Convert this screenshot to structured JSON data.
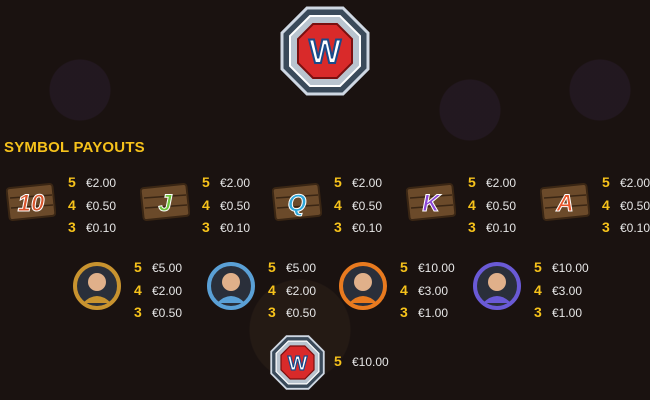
{
  "title": "SYMBOL PAYOUTS",
  "colors": {
    "accent": "#f6c21b",
    "text": "#e6e6e6",
    "wild_red": "#d92a2a",
    "background": "#1a1210"
  },
  "wild_top": {
    "icon": "wild-w-icon",
    "letter": "W"
  },
  "row1": [
    {
      "icon": "card-10-icon",
      "letter": "10",
      "color": "#d9542a",
      "pays": [
        {
          "count": "5",
          "amount": "€2.00"
        },
        {
          "count": "4",
          "amount": "€0.50"
        },
        {
          "count": "3",
          "amount": "€0.10"
        }
      ]
    },
    {
      "icon": "card-j-icon",
      "letter": "J",
      "color": "#6cc23a",
      "pays": [
        {
          "count": "5",
          "amount": "€2.00"
        },
        {
          "count": "4",
          "amount": "€0.50"
        },
        {
          "count": "3",
          "amount": "€0.10"
        }
      ]
    },
    {
      "icon": "card-q-icon",
      "letter": "Q",
      "color": "#2fa7d9",
      "pays": [
        {
          "count": "5",
          "amount": "€2.00"
        },
        {
          "count": "4",
          "amount": "€0.50"
        },
        {
          "count": "3",
          "amount": "€0.10"
        }
      ]
    },
    {
      "icon": "card-k-icon",
      "letter": "K",
      "color": "#8b46d6",
      "pays": [
        {
          "count": "5",
          "amount": "€2.00"
        },
        {
          "count": "4",
          "amount": "€0.50"
        },
        {
          "count": "3",
          "amount": "€0.10"
        }
      ]
    },
    {
      "icon": "card-a-icon",
      "letter": "A",
      "color": "#e8562a",
      "pays": [
        {
          "count": "5",
          "amount": "€2.00"
        },
        {
          "count": "4",
          "amount": "€0.50"
        },
        {
          "count": "3",
          "amount": "€0.10"
        }
      ]
    }
  ],
  "row2": [
    {
      "icon": "bearded-fighter-icon",
      "ring": "#c8932f",
      "pays": [
        {
          "count": "5",
          "amount": "€5.00"
        },
        {
          "count": "4",
          "amount": "€2.00"
        },
        {
          "count": "3",
          "amount": "€0.50"
        }
      ]
    },
    {
      "icon": "silver-fighter-icon",
      "ring": "#5aa0d6",
      "pays": [
        {
          "count": "5",
          "amount": "€5.00"
        },
        {
          "count": "4",
          "amount": "€2.00"
        },
        {
          "count": "3",
          "amount": "€0.50"
        }
      ]
    },
    {
      "icon": "blonde-fighter-icon",
      "ring": "#e87a1f",
      "pays": [
        {
          "count": "5",
          "amount": "€10.00"
        },
        {
          "count": "4",
          "amount": "€3.00"
        },
        {
          "count": "3",
          "amount": "€1.00"
        }
      ]
    },
    {
      "icon": "masked-ninja-icon",
      "ring": "#6a5ad6",
      "pays": [
        {
          "count": "5",
          "amount": "€10.00"
        },
        {
          "count": "4",
          "amount": "€3.00"
        },
        {
          "count": "3",
          "amount": "€1.00"
        }
      ]
    }
  ],
  "wild_bottom": {
    "icon": "wild-w-icon",
    "letter": "W",
    "pays": [
      {
        "count": "5",
        "amount": "€10.00"
      }
    ]
  }
}
